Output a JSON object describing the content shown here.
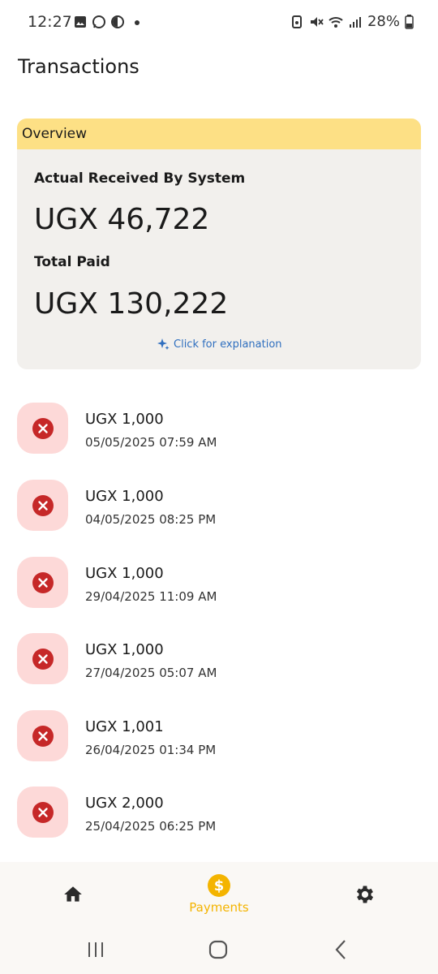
{
  "status": {
    "time": "12:27",
    "battery": "28%"
  },
  "page": {
    "title": "Transactions"
  },
  "overview": {
    "header": "Overview",
    "received_label": "Actual Received By System",
    "received_value": "UGX 46,722",
    "paid_label": "Total Paid",
    "paid_value": "UGX 130,222",
    "explain_link": "Click for explanation"
  },
  "transactions": [
    {
      "amount": "UGX 1,000",
      "date": "05/05/2025 07:59 AM",
      "status_icon": "failed-x-icon"
    },
    {
      "amount": "UGX 1,000",
      "date": "04/05/2025 08:25 PM",
      "status_icon": "failed-x-icon"
    },
    {
      "amount": "UGX 1,000",
      "date": "29/04/2025 11:09 AM",
      "status_icon": "failed-x-icon"
    },
    {
      "amount": "UGX 1,000",
      "date": "27/04/2025 05:07 AM",
      "status_icon": "failed-x-icon"
    },
    {
      "amount": "UGX 1,001",
      "date": "26/04/2025 01:34 PM",
      "status_icon": "failed-x-icon"
    },
    {
      "amount": "UGX 2,000",
      "date": "25/04/2025 06:25 PM",
      "status_icon": "failed-x-icon"
    }
  ],
  "nav": {
    "payments_label": "Payments"
  },
  "colors": {
    "accent": "#f4b400",
    "error": "#c62828",
    "overview_header": "#fde085",
    "link": "#2f6fbf"
  }
}
